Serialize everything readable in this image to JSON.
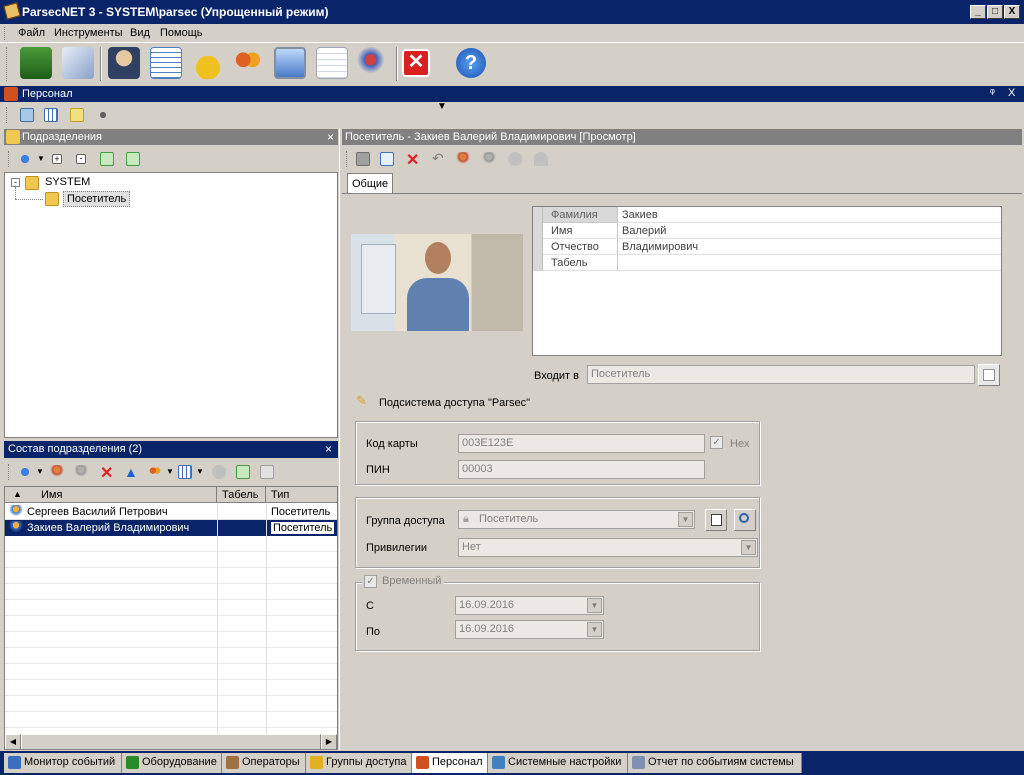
{
  "window": {
    "title": "ParsecNET 3 - SYSTEM\\parsec (Упрощенный режим)",
    "min": "_",
    "max": "□",
    "close": "X"
  },
  "menu": [
    "Файл",
    "Инструменты",
    "Вид",
    "Помощь"
  ],
  "dock": {
    "title": "Персонал",
    "pin": "ᵠ",
    "close": "X"
  },
  "subdivisions": {
    "title": "Подразделения",
    "close": "×",
    "tree": {
      "root": "SYSTEM",
      "child": "Посетитель"
    }
  },
  "members": {
    "title": "Состав подразделения (2)",
    "close": "×",
    "columns": [
      "Имя",
      "Табель",
      "Тип"
    ],
    "rows": [
      {
        "name": "Сергеев Василий Петрович",
        "tab": "",
        "type": "Посетитель"
      },
      {
        "name": "Закиев Валерий Владимирович",
        "tab": "",
        "type": "Посетитель"
      }
    ]
  },
  "visitor": {
    "title": "Посетитель - Закиев Валерий Владимирович [Просмотр]",
    "tab": "Общие",
    "props": [
      {
        "k": "Фамилия",
        "v": "Закиев"
      },
      {
        "k": "Имя",
        "v": "Валерий"
      },
      {
        "k": "Отчество",
        "v": "Владимирович"
      },
      {
        "k": "Табель",
        "v": ""
      }
    ],
    "member_of_label": "Входит в",
    "member_of": "Посетитель",
    "subsystem": "Подсистема доступа \"Parsec\"",
    "card_label": "Код карты",
    "card": "003E123E",
    "hex": "Hex",
    "pin_label": "ПИН",
    "pin": "00003",
    "group_label": "Группа доступа",
    "group": "Посетитель",
    "priv_label": "Привилегии",
    "priv": "Нет",
    "temp_label": "Временный",
    "from_label": "С",
    "from": "16.09.2016",
    "to_label": "По",
    "to": "16.09.2016"
  },
  "taskbar": [
    {
      "label": "Монитор событий",
      "color": "#3a6ec0"
    },
    {
      "label": "Оборудование",
      "color": "#2a8a2a"
    },
    {
      "label": "Операторы",
      "color": "#a07040"
    },
    {
      "label": "Группы доступа",
      "color": "#e0b020"
    },
    {
      "label": "Персонал",
      "color": "#d05020"
    },
    {
      "label": "Системные настройки",
      "color": "#4080c0"
    },
    {
      "label": "Отчет по событиям системы",
      "color": "#8090b0"
    }
  ]
}
